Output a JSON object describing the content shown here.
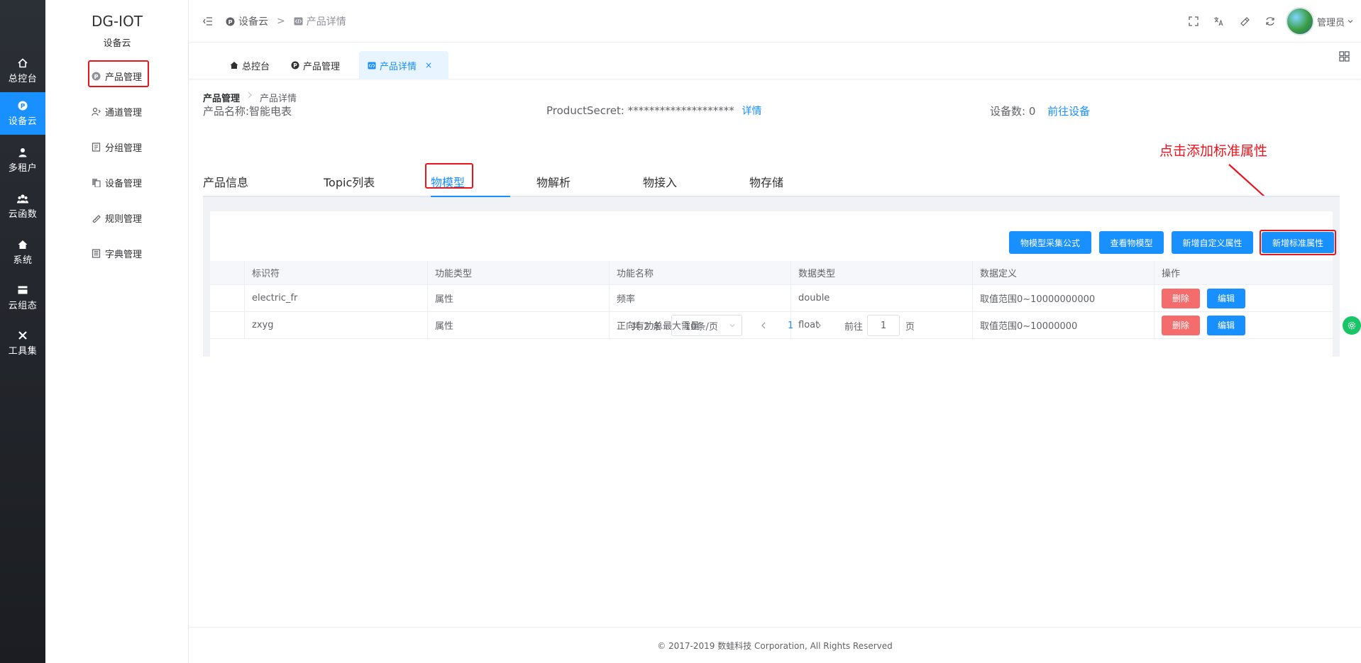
{
  "rail": {
    "items": [
      {
        "label": "总控台",
        "icon": "home-icon"
      },
      {
        "label": "设备云",
        "icon": "p-circle-icon"
      },
      {
        "label": "多租户",
        "icon": "user-icon"
      },
      {
        "label": "云函数",
        "icon": "users-icon"
      },
      {
        "label": "系统",
        "icon": "house-icon"
      },
      {
        "label": "云组态",
        "icon": "card-icon"
      },
      {
        "label": "工具集",
        "icon": "tools-icon"
      }
    ],
    "active_index": 1
  },
  "subnav": {
    "brand": "DG-IOT",
    "brand_sub": "设备云",
    "items": [
      {
        "label": "产品管理",
        "icon": "product-icon"
      },
      {
        "label": "通道管理",
        "icon": "channel-icon"
      },
      {
        "label": "分组管理",
        "icon": "group-icon"
      },
      {
        "label": "设备管理",
        "icon": "device-icon"
      },
      {
        "label": "规则管理",
        "icon": "rule-icon"
      },
      {
        "label": "字典管理",
        "icon": "dict-icon"
      }
    ]
  },
  "header": {
    "crumb_1": "设备云",
    "crumb_sep": ">",
    "crumb_2": "产品详情",
    "user": "管理员"
  },
  "tags": [
    {
      "label": "总控台",
      "icon": "home-icon"
    },
    {
      "label": "产品管理",
      "icon": "p-circle-icon"
    },
    {
      "label": "产品详情",
      "icon": "code-icon",
      "close": "×"
    }
  ],
  "page": {
    "crumb_parent": "产品管理",
    "crumb_current": "产品详情",
    "product_name": "产品名称:智能电表",
    "secret_label": "ProductSecret: ********************",
    "secret_link": "详情",
    "device_count": "设备数: 0",
    "device_link": "前往设备"
  },
  "tabs": [
    "产品信息",
    "Topic列表",
    "物模型",
    "物解析",
    "物接入",
    "物存储"
  ],
  "active_tab": 2,
  "buttons": {
    "formula": "物模型采集公式",
    "view": "查看物模型",
    "custom": "新增自定义属性",
    "standard": "新增标准属性"
  },
  "table": {
    "columns": [
      "",
      "标识符",
      "功能类型",
      "功能名称",
      "数据类型",
      "数据定义",
      "操作"
    ],
    "rows": [
      {
        "id": "electric_fr",
        "type": "属性",
        "name": "频率",
        "datatype": "double",
        "def": "取值范围0~10000000000"
      },
      {
        "id": "zxyg",
        "type": "属性",
        "name": "正向有功总最大需量",
        "datatype": "float",
        "def": "取值范围0~10000000"
      }
    ],
    "delete_label": "删除",
    "edit_label": "编辑"
  },
  "pager": {
    "total": "共 2 条",
    "size": "10条/页",
    "page": "1",
    "goto_label": "前往",
    "goto_value": "1",
    "page_unit": "页"
  },
  "annotation": "点击添加标准属性",
  "footer": "© 2017-2019 数蛙科技 Corporation, All Rights Reserved",
  "colors": {
    "primary": "#1890ff",
    "danger": "#f56c6c",
    "highlight": "#e8141e",
    "rail": "#1f2228"
  }
}
